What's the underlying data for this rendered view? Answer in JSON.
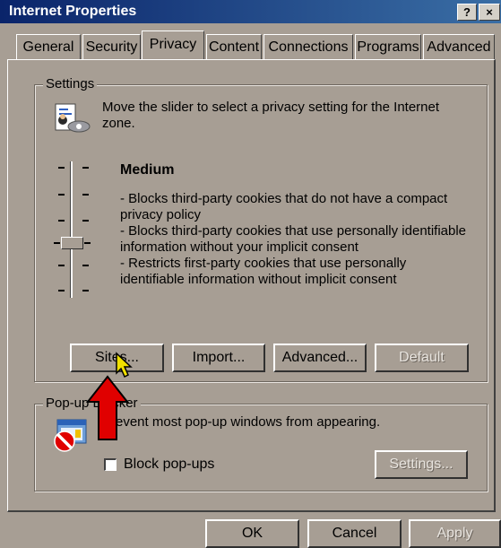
{
  "window": {
    "title": "Internet Properties",
    "help_label": "?",
    "close_label": "×"
  },
  "tabs": [
    {
      "label": "General",
      "active": false
    },
    {
      "label": "Security",
      "active": false
    },
    {
      "label": "Privacy",
      "active": true
    },
    {
      "label": "Content",
      "active": false
    },
    {
      "label": "Connections",
      "active": false
    },
    {
      "label": "Programs",
      "active": false
    },
    {
      "label": "Advanced",
      "active": false
    }
  ],
  "settings": {
    "group_label": "Settings",
    "instruction": "Move the slider to select a privacy setting for the Internet zone.",
    "level_title": "Medium",
    "level_points": [
      "- Blocks third-party cookies that do not have a compact privacy policy",
      "- Blocks third-party cookies that use personally identifiable information without your implicit consent",
      "- Restricts first-party cookies that use personally identifiable information without implicit consent"
    ],
    "slider_position": "4 of 6",
    "buttons": {
      "sites": "Sites...",
      "import": "Import...",
      "advanced": "Advanced...",
      "default": "Default"
    }
  },
  "popup": {
    "group_label": "Pop-up Blocker",
    "instruction": "Prevent most pop-up windows from appearing.",
    "checkbox_label": "Block pop-ups",
    "checkbox_checked": false,
    "settings_button": "Settings..."
  },
  "footer": {
    "ok": "OK",
    "cancel": "Cancel",
    "apply": "Apply"
  },
  "icons": [
    "privacy-icon",
    "popup-blocker-icon",
    "red-arrow-annotation",
    "mouse-cursor"
  ],
  "colors": {
    "dialog_bg": "#a79e94",
    "titlebar": "#0a246a",
    "arrow": "#e00000"
  }
}
